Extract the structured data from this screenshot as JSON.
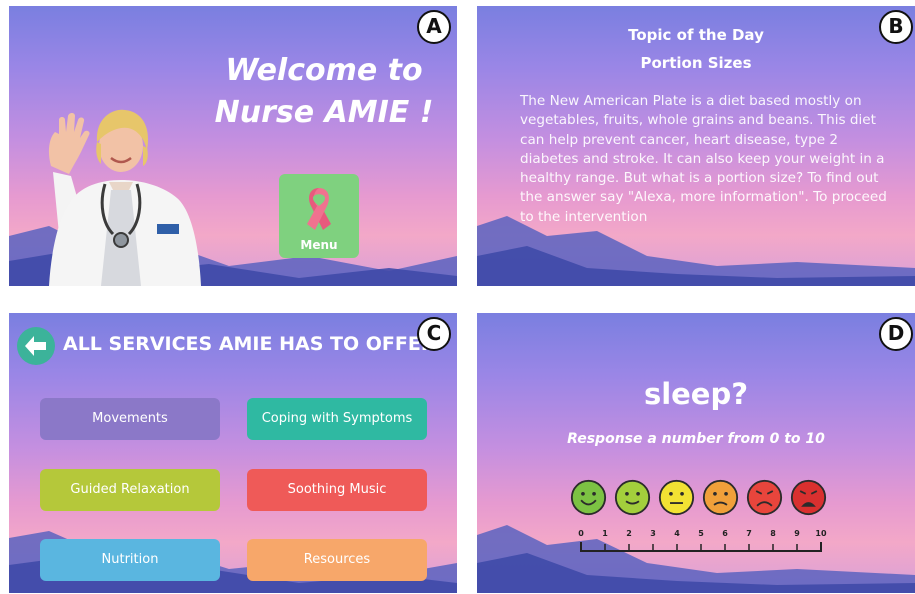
{
  "panels": {
    "a": {
      "badge": "A",
      "welcome_line1": "Welcome to",
      "welcome_line2": "Nurse AMIE !",
      "menu_label": "Menu",
      "menu_icon": "ribbon-icon"
    },
    "b": {
      "badge": "B",
      "title": "Topic of the Day",
      "subtitle": "Portion Sizes",
      "body": "The New American Plate is a diet based mostly on vegetables, fruits, whole grains and beans. This diet can help prevent cancer, heart disease, type 2 diabetes and stroke. It can also keep your weight in a healthy range. But what is a portion size? To find out the answer say \"Alexa, more information\". To proceed to the intervention"
    },
    "c": {
      "badge": "C",
      "title": "ALL SERVICES AMIE HAS TO OFFER",
      "back_icon": "back-arrow-icon",
      "services": [
        {
          "label": "Movements",
          "color": "#8b78c8"
        },
        {
          "label": "Coping with Symptoms",
          "color": "#2fb9a2"
        },
        {
          "label": "Guided Relaxation",
          "color": "#b5c83a"
        },
        {
          "label": "Soothing Music",
          "color": "#ef5a58"
        },
        {
          "label": "Nutrition",
          "color": "#5ab6e0"
        },
        {
          "label": "Resources",
          "color": "#f7a76a"
        }
      ]
    },
    "d": {
      "badge": "D",
      "question": "sleep?",
      "instruction": "Response a number from 0 to 10",
      "faces": [
        {
          "icon": "very-happy-face-icon",
          "color": "#7cc243"
        },
        {
          "icon": "happy-face-icon",
          "color": "#a3cf3c"
        },
        {
          "icon": "neutral-face-icon",
          "color": "#f2e233"
        },
        {
          "icon": "sad-face-icon",
          "color": "#f0a03a"
        },
        {
          "icon": "very-sad-face-icon",
          "color": "#e8453c"
        },
        {
          "icon": "crying-face-icon",
          "color": "#d9302f"
        }
      ],
      "scale_labels": [
        "0",
        "1",
        "2",
        "3",
        "4",
        "5",
        "6",
        "7",
        "8",
        "9",
        "10"
      ]
    }
  }
}
